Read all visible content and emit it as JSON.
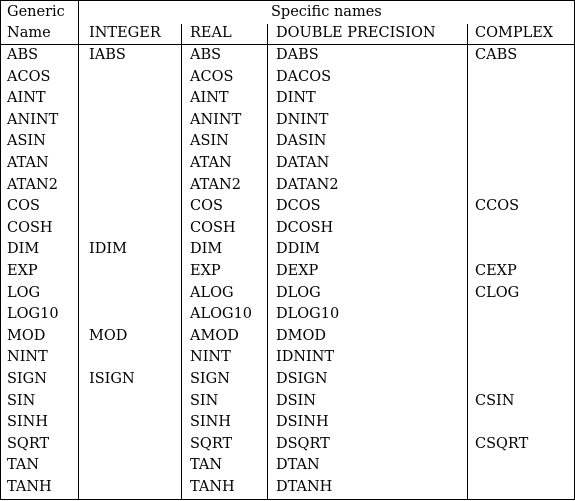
{
  "header": {
    "generic_line1": "Generic",
    "generic_line2": "Name",
    "specific": "Specific names",
    "columns": [
      "INTEGER",
      "REAL",
      "DOUBLE PRECISION",
      "COMPLEX"
    ]
  },
  "rows": [
    [
      "ABS",
      "IABS",
      "ABS",
      "DABS",
      "CABS"
    ],
    [
      "ACOS",
      "",
      "ACOS",
      "DACOS",
      ""
    ],
    [
      "AINT",
      "",
      "AINT",
      "DINT",
      ""
    ],
    [
      "ANINT",
      "",
      "ANINT",
      "DNINT",
      ""
    ],
    [
      "ASIN",
      "",
      "ASIN",
      "DASIN",
      ""
    ],
    [
      "ATAN",
      "",
      "ATAN",
      "DATAN",
      ""
    ],
    [
      "ATAN2",
      "",
      "ATAN2",
      "DATAN2",
      ""
    ],
    [
      "COS",
      "",
      "COS",
      "DCOS",
      "CCOS"
    ],
    [
      "COSH",
      "",
      "COSH",
      "DCOSH",
      ""
    ],
    [
      "DIM",
      "IDIM",
      "DIM",
      "DDIM",
      ""
    ],
    [
      "EXP",
      "",
      "EXP",
      "DEXP",
      "CEXP"
    ],
    [
      "LOG",
      "",
      "ALOG",
      "DLOG",
      "CLOG"
    ],
    [
      "LOG10",
      "",
      "ALOG10",
      "DLOG10",
      ""
    ],
    [
      "MOD",
      "MOD",
      "AMOD",
      "DMOD",
      ""
    ],
    [
      "NINT",
      "",
      "NINT",
      "IDNINT",
      ""
    ],
    [
      "SIGN",
      "ISIGN",
      "SIGN",
      "DSIGN",
      ""
    ],
    [
      "SIN",
      "",
      "SIN",
      "DSIN",
      "CSIN"
    ],
    [
      "SINH",
      "",
      "SINH",
      "DSINH",
      ""
    ],
    [
      "SQRT",
      "",
      "SQRT",
      "DSQRT",
      "CSQRT"
    ],
    [
      "TAN",
      "",
      "TAN",
      "DTAN",
      ""
    ],
    [
      "TANH",
      "",
      "TANH",
      "DTANH",
      ""
    ]
  ]
}
